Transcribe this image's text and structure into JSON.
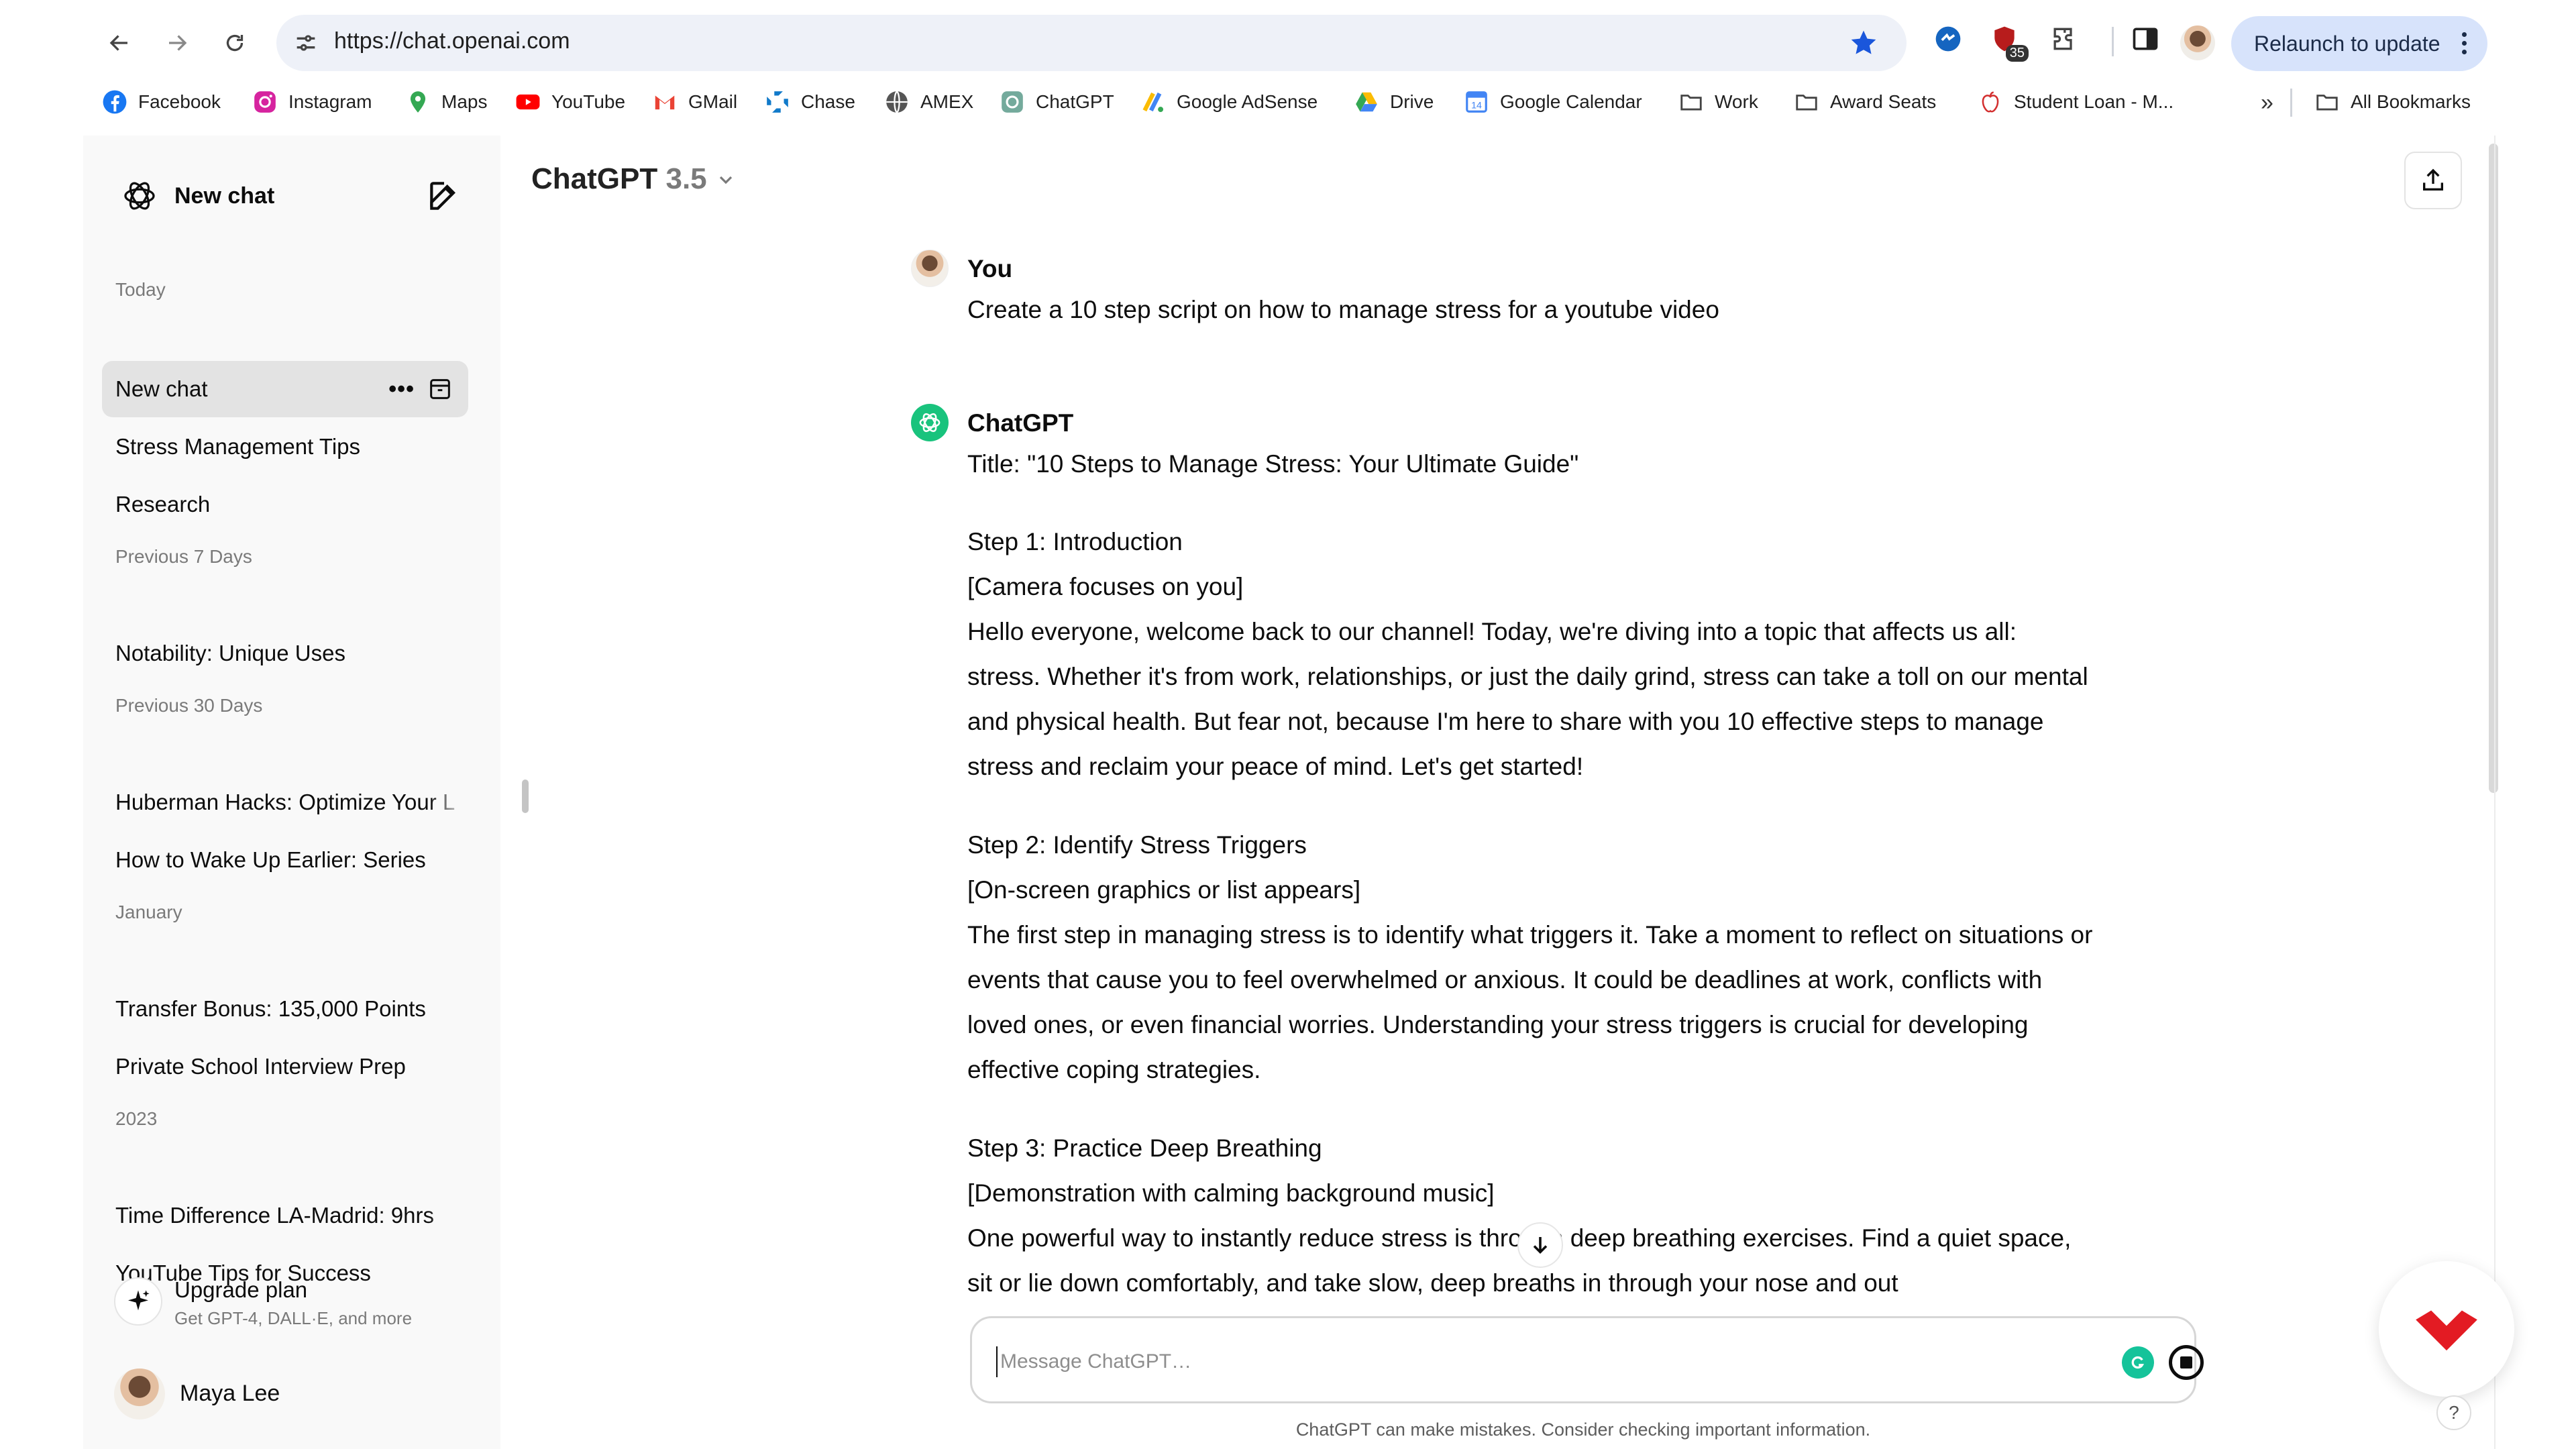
{
  "browser": {
    "url": "https://chat.openai.com",
    "extension_badge": "35",
    "relaunch_label": "Relaunch to update",
    "bookmarks": [
      {
        "label": "Facebook",
        "icon": "facebook-icon"
      },
      {
        "label": "Instagram",
        "icon": "instagram-icon"
      },
      {
        "label": "Maps",
        "icon": "maps-icon"
      },
      {
        "label": "YouTube",
        "icon": "youtube-icon"
      },
      {
        "label": "GMail",
        "icon": "gmail-icon"
      },
      {
        "label": "Chase",
        "icon": "chase-icon"
      },
      {
        "label": "AMEX",
        "icon": "globe-icon"
      },
      {
        "label": "ChatGPT",
        "icon": "chatgpt-icon"
      },
      {
        "label": "Google AdSense",
        "icon": "adsense-icon"
      },
      {
        "label": "Drive",
        "icon": "drive-icon"
      },
      {
        "label": "Google Calendar",
        "icon": "calendar-icon"
      },
      {
        "label": "Work",
        "icon": "folder-icon"
      },
      {
        "label": "Award Seats",
        "icon": "folder-icon"
      },
      {
        "label": "Student Loan - M...",
        "icon": "apple-icon"
      }
    ],
    "more_bookmarks": "»",
    "all_bookmarks": "All Bookmarks"
  },
  "sidebar": {
    "new_chat": "New chat",
    "sections": [
      {
        "heading": "Today",
        "items": [
          "New chat",
          "Stress Management Tips",
          "Research"
        ]
      },
      {
        "heading": "Previous 7 Days",
        "items": [
          "Notability: Unique Uses"
        ]
      },
      {
        "heading": "Previous 30 Days",
        "items": [
          "Huberman Hacks: Optimize Your L",
          "How to Wake Up Earlier: Series"
        ]
      },
      {
        "heading": "January",
        "items": [
          "Transfer Bonus: 135,000 Points",
          "Private School Interview Prep"
        ]
      },
      {
        "heading": "2023",
        "items": [
          "Time Difference LA-Madrid: 9hrs",
          "YouTube Tips for Success"
        ]
      }
    ],
    "active_more": "•••",
    "upgrade_title": "Upgrade plan",
    "upgrade_sub": "Get GPT-4, DALL·E, and more",
    "user_name": "Maya Lee"
  },
  "header": {
    "model_name": "ChatGPT",
    "model_version": "3.5"
  },
  "conversation": {
    "user_role": "You",
    "user_message": "Create a 10 step script on how to manage stress for a youtube video",
    "assistant_role": "ChatGPT",
    "title_line": "Title: \"10 Steps to Manage Stress: Your Ultimate Guide\"",
    "step1_heading": "Step 1: Introduction",
    "step1_direction": "[Camera focuses on you]",
    "step1_body": "Hello everyone, welcome back to our channel! Today, we're diving into a topic that affects us all: stress. Whether it's from work, relationships, or just the daily grind, stress can take a toll on our mental and physical health. But fear not, because I'm here to share with you 10 effective steps to manage stress and reclaim your peace of mind. Let's get started!",
    "step2_heading": "Step 2: Identify Stress Triggers",
    "step2_direction": "[On-screen graphics or list appears]",
    "step2_body": "The first step in managing stress is to identify what triggers it. Take a moment to reflect on situations or events that cause you to feel overwhelmed or anxious. It could be deadlines at work, conflicts with loved ones, or even financial worries. Understanding your stress triggers is crucial for developing effective coping strategies.",
    "step3_heading": "Step 3: Practice Deep Breathing",
    "step3_direction": "[Demonstration with calming background music]",
    "step3_body": "One powerful way to instantly reduce stress is through deep breathing exercises. Find a quiet space, sit or lie down comfortably, and take slow, deep breaths in through your nose and out"
  },
  "composer": {
    "placeholder": "Message ChatGPT…",
    "disclaimer": "ChatGPT can make mistakes. Consider checking important information."
  },
  "help_label": "?"
}
